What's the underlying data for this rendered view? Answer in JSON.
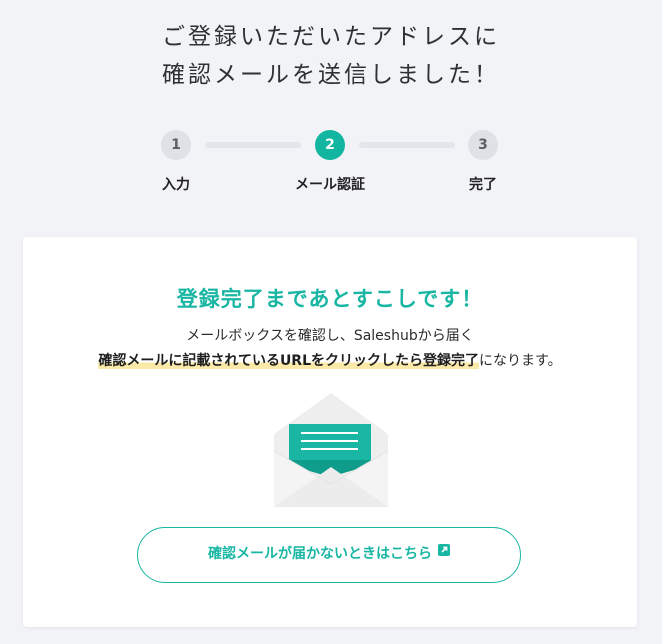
{
  "header": {
    "line1": "ご登録いただいたアドレスに",
    "line2": "確認メールを送信しました！"
  },
  "stepper": {
    "steps": [
      {
        "number": "1",
        "label": "入力",
        "active": false
      },
      {
        "number": "2",
        "label": "メール認証",
        "active": true
      },
      {
        "number": "3",
        "label": "完了",
        "active": false
      }
    ]
  },
  "card": {
    "title": "登録完了まであとすこしです！",
    "line1": "メールボックスを確認し、Saleshubから届く",
    "line2_highlight": "確認メールに記載されているURLをクリックしたら登録完了",
    "line2_rest": "になります。",
    "envelope_icon": "open-envelope-icon",
    "cta_label": "確認メールが届かないときはこちら",
    "cta_icon": "external-link-icon"
  },
  "colors": {
    "accent": "#18b6a3",
    "background": "#f2f3f6",
    "highlight": "#fbe9a8"
  }
}
